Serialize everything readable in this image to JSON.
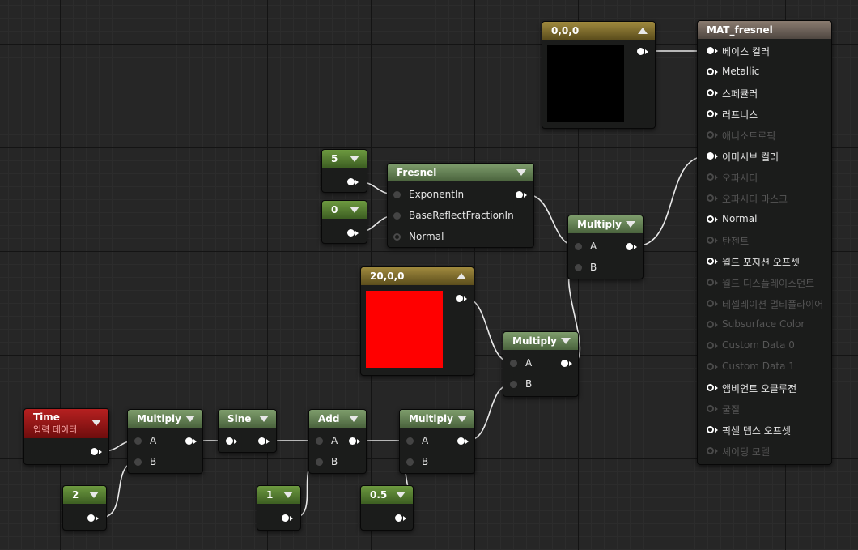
{
  "nodes": {
    "color_black": {
      "title": "0,0,0",
      "color": "#000000"
    },
    "color_red": {
      "title": "20,0,0",
      "color": "#ff0000"
    },
    "const5": {
      "title": "5"
    },
    "const0": {
      "title": "0"
    },
    "const2": {
      "title": "2"
    },
    "const1": {
      "title": "1"
    },
    "const05": {
      "title": "0.5"
    },
    "fresnel": {
      "title": "Fresnel",
      "pins": [
        "ExponentIn",
        "BaseReflectFractionIn",
        "Normal"
      ]
    },
    "time": {
      "title": "Time",
      "subtitle": "입력 데이터"
    },
    "mult_a": {
      "title": "Multiply",
      "pin_a": "A",
      "pin_b": "B"
    },
    "sine": {
      "title": "Sine"
    },
    "add": {
      "title": "Add",
      "pin_a": "A",
      "pin_b": "B"
    },
    "mult_b": {
      "title": "Multiply",
      "pin_a": "A",
      "pin_b": "B"
    },
    "mult_c": {
      "title": "Multiply",
      "pin_a": "A",
      "pin_b": "B"
    },
    "mult_d": {
      "title": "Multiply",
      "pin_a": "A",
      "pin_b": "B"
    }
  },
  "material": {
    "title": "MAT_fresnel",
    "inputs": [
      {
        "label": "베이스 컬러",
        "active": true
      },
      {
        "label": "Metallic",
        "active": true
      },
      {
        "label": "스페큘러",
        "active": true
      },
      {
        "label": "러프니스",
        "active": true
      },
      {
        "label": "애니소트로픽",
        "active": false
      },
      {
        "label": "이미시브 컬러",
        "active": true
      },
      {
        "label": "오파시티",
        "active": false
      },
      {
        "label": "오파시티 마스크",
        "active": false
      },
      {
        "label": "Normal",
        "active": true
      },
      {
        "label": "탄젠트",
        "active": false
      },
      {
        "label": "월드 포지션 오프셋",
        "active": true
      },
      {
        "label": "월드 디스플레이스먼트",
        "active": false
      },
      {
        "label": "테셀레이션 멀티플라이어",
        "active": false
      },
      {
        "label": "Subsurface Color",
        "active": false
      },
      {
        "label": "Custom Data 0",
        "active": false
      },
      {
        "label": "Custom Data 1",
        "active": false
      },
      {
        "label": "앰비언트 오클루전",
        "active": true
      },
      {
        "label": "굴절",
        "active": false
      },
      {
        "label": "픽셀 뎁스 오프셋",
        "active": true
      },
      {
        "label": "셰이딩 모델",
        "active": false
      }
    ]
  }
}
